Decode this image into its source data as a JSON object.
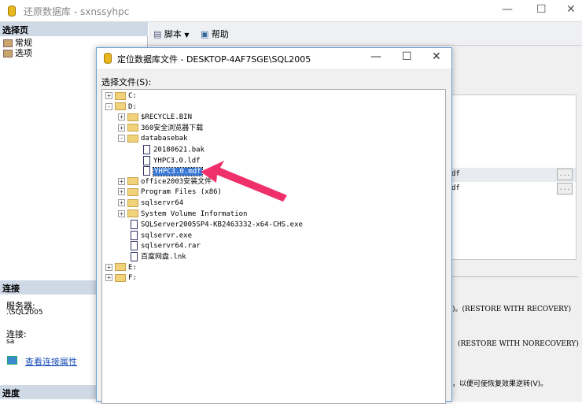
{
  "window": {
    "title": "还原数据库 - sxnssyhpc"
  },
  "left": {
    "select_page": "选择页",
    "pages": [
      "常规",
      "选项"
    ],
    "connection": "连接",
    "server_label": "服务器:",
    "server_value": ".\\SQL2005",
    "conn_label": "连接:",
    "conn_value": "sa",
    "view_props": "查看连接属性",
    "progress": "进度"
  },
  "toolbar": {
    "script": "脚本",
    "help": "帮助"
  },
  "right": {
    "rows": [
      "df",
      "df"
    ],
    "browse": "...",
    "options": [
      ")。(RESTORE WITH RECOVERY)",
      "(RESTORE WITH NORECOVERY)",
      "，以便可使恢复效果逆转(V)。"
    ]
  },
  "dialog": {
    "title": "定位数据库文件 - DESKTOP-4AF7SGE\\SQL2005",
    "label": "选择文件(S):",
    "tree": [
      {
        "label": "C:",
        "type": "folder",
        "level": 0,
        "exp": "+"
      },
      {
        "label": "D:",
        "type": "folder",
        "level": 0,
        "exp": "-"
      },
      {
        "label": "$RECYCLE.BIN",
        "type": "folder",
        "level": 1,
        "exp": "+"
      },
      {
        "label": "360安全浏览器下载",
        "type": "folder",
        "level": 1,
        "exp": "+"
      },
      {
        "label": "databasebak",
        "type": "folder",
        "level": 1,
        "exp": "-"
      },
      {
        "label": "20180621.bak",
        "type": "file",
        "level": 2
      },
      {
        "label": "YHPC3.0.ldf",
        "type": "file",
        "level": 2
      },
      {
        "label": "YHPC3.0.mdf",
        "type": "file",
        "level": 2,
        "selected": true
      },
      {
        "label": "office2003安装文件",
        "type": "folder",
        "level": 1,
        "exp": "+"
      },
      {
        "label": "Program Files (x86)",
        "type": "folder",
        "level": 1,
        "exp": "+"
      },
      {
        "label": "sqlservr64",
        "type": "folder",
        "level": 1,
        "exp": "+"
      },
      {
        "label": "System Volume Information",
        "type": "folder",
        "level": 1,
        "exp": "+"
      },
      {
        "label": "SQLServer2005SP4-KB2463332-x64-CHS.exe",
        "type": "file",
        "level": 1
      },
      {
        "label": "sqlservr.exe",
        "type": "file",
        "level": 1
      },
      {
        "label": "sqlservr64.rar",
        "type": "file",
        "level": 1
      },
      {
        "label": "百度网盘.lnk",
        "type": "file",
        "level": 1
      },
      {
        "label": "E:",
        "type": "folder",
        "level": 0,
        "exp": "+"
      },
      {
        "label": "F:",
        "type": "folder",
        "level": 0,
        "exp": "+"
      }
    ]
  },
  "colors": {
    "selection": "#3a78d6",
    "arrow": "#f0306a",
    "header": "#cfd9e6"
  }
}
